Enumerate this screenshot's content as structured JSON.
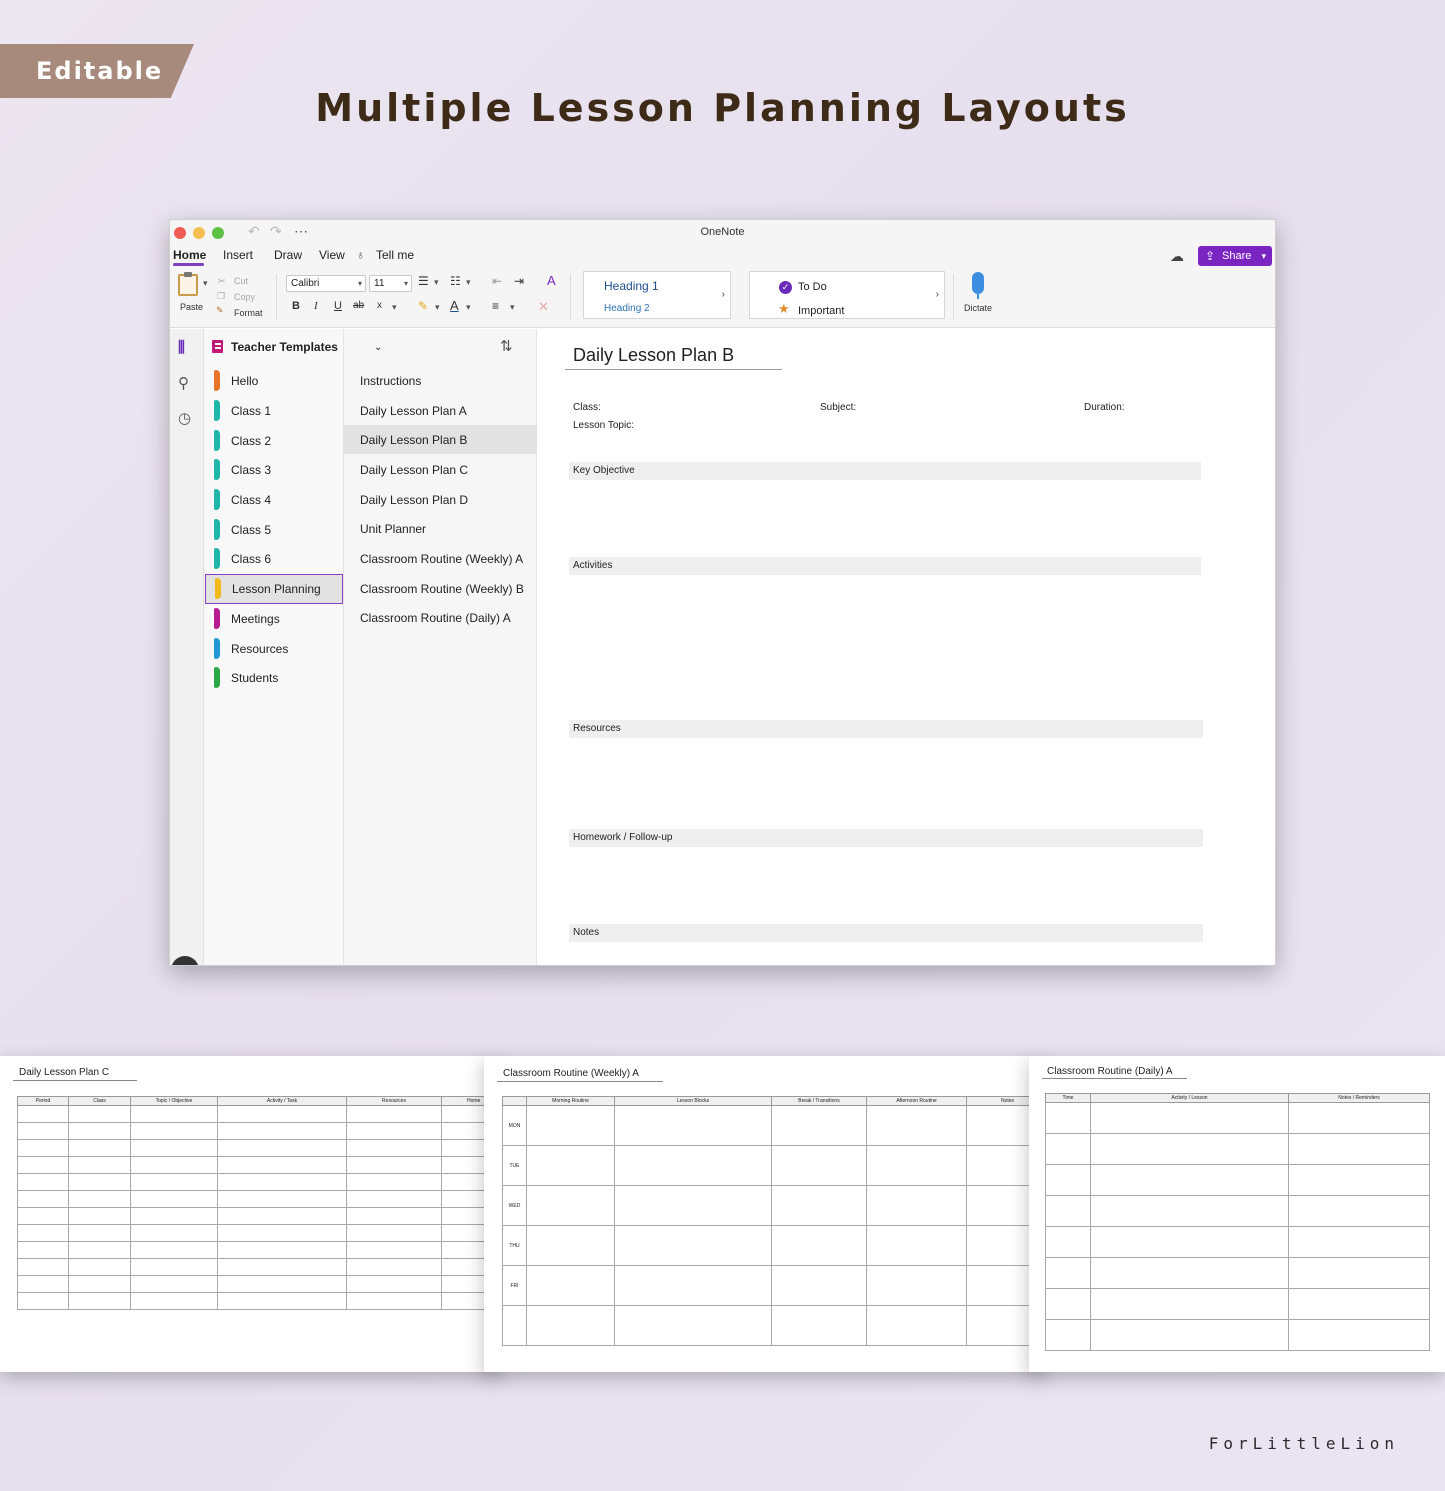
{
  "banner": {
    "tag": "Editable",
    "heading": "Multiple Lesson Planning Layouts",
    "brand": "ForLittleLion"
  },
  "window": {
    "title": "OneNote",
    "menu": [
      "Home",
      "Insert",
      "Draw",
      "View",
      "Tell me"
    ],
    "share_label": "Share",
    "ribbon": {
      "paste": "Paste",
      "cut": "Cut",
      "copy": "Copy",
      "format": "Format",
      "font": "Calibri",
      "size": "11",
      "bold": "B",
      "italic": "I",
      "underline": "U",
      "strike": "ab",
      "subscript": "x",
      "heading1": "Heading 1",
      "heading2": "Heading 2",
      "todo": "To Do",
      "important": "Important",
      "dictate": "Dictate"
    },
    "notebook": "Teacher Templates",
    "sections": [
      {
        "label": "Hello",
        "color": "#e8742a"
      },
      {
        "label": "Class 1",
        "color": "#1fb5a8"
      },
      {
        "label": "Class 2",
        "color": "#1fb5a8"
      },
      {
        "label": "Class 3",
        "color": "#1fb5a8"
      },
      {
        "label": "Class 4",
        "color": "#1fb5a8"
      },
      {
        "label": "Class 5",
        "color": "#1fb5a8"
      },
      {
        "label": "Class 6",
        "color": "#1fb5a8"
      },
      {
        "label": "Lesson Planning",
        "color": "#f2b81c"
      },
      {
        "label": "Meetings",
        "color": "#b81c8e"
      },
      {
        "label": "Resources",
        "color": "#2498d6"
      },
      {
        "label": "Students",
        "color": "#2aa845"
      }
    ],
    "selected_section": "Lesson Planning",
    "pages": [
      "Instructions",
      "Daily Lesson Plan A",
      "Daily Lesson Plan B",
      "Daily Lesson Plan C",
      "Daily Lesson Plan D",
      "Unit Planner",
      "Classroom Routine (Weekly) A",
      "Classroom Routine (Weekly) B",
      "Classroom Routine (Daily) A"
    ],
    "selected_page": "Daily Lesson Plan B",
    "note": {
      "title": "Daily Lesson Plan B",
      "class_label": "Class:",
      "subject_label": "Subject:",
      "duration_label": "Duration:",
      "topic_label": "Lesson Topic:",
      "sections": [
        "Key Objective",
        "Activities",
        "Resources",
        "Homework / Follow-up",
        "Notes"
      ]
    }
  },
  "previews": {
    "plan_c": {
      "title": "Daily Lesson Plan C",
      "headers": [
        "Period",
        "Class",
        "Topic / Objective",
        "Activity / Task",
        "Resources",
        "Home"
      ]
    },
    "weekly_a": {
      "title": "Classroom Routine (Weekly) A",
      "headers": [
        "",
        "Morning Routine",
        "Lesson Blocks",
        "Break / Transitions",
        "Afternoon Routine",
        "Notes"
      ],
      "days": [
        "MON",
        "TUE",
        "WED",
        "THU",
        "FRI",
        ""
      ]
    },
    "daily_a": {
      "title": "Classroom Routine (Daily) A",
      "headers": [
        "Time",
        "Activity / Lesson",
        "Notes / Reminders"
      ]
    }
  }
}
